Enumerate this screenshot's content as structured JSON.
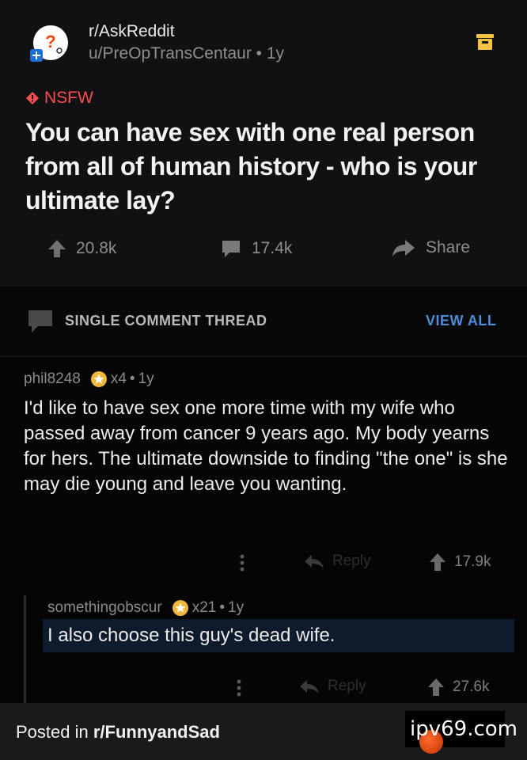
{
  "post": {
    "subreddit": "r/AskReddit",
    "author": "u/PreOpTransCentaur",
    "age": "1y",
    "nsfw_label": "NSFW",
    "title": "You can have sex with one real person from all of human history - who is your ultimate lay?",
    "upvotes": "20.8k",
    "comments": "17.4k",
    "share_label": "Share"
  },
  "thread_bar": {
    "label": "SINGLE COMMENT THREAD",
    "view_all": "VIEW ALL"
  },
  "comments": [
    {
      "username": "phil8248",
      "award_count": "x4",
      "age": "1y",
      "body": "I'd like to have sex one more time with my wife who passed away from cancer 9 years ago. My body yearns for hers. The ultimate downside to finding \"the one\" is she may die young and leave you wanting.",
      "reply_label": "Reply",
      "votes": "17.9k"
    },
    {
      "username": "somethingobscur",
      "award_count": "x21",
      "age": "1y",
      "body": "I also choose this guy's dead wife.",
      "reply_label": "Reply",
      "votes": "27.6k"
    }
  ],
  "footer": {
    "prefix": "Posted in ",
    "subreddit": "r/FunnyandSad"
  },
  "watermark": "ipv69.com",
  "colors": {
    "nsfw": "#ff4d4d",
    "link": "#4d8ed8",
    "background": "#050505"
  },
  "icons": [
    "subreddit-avatar-icon",
    "save-icon",
    "nsfw-icon",
    "upvote-icon",
    "comment-icon",
    "share-icon",
    "thread-icon",
    "award-icon",
    "more-icon",
    "reply-icon"
  ]
}
